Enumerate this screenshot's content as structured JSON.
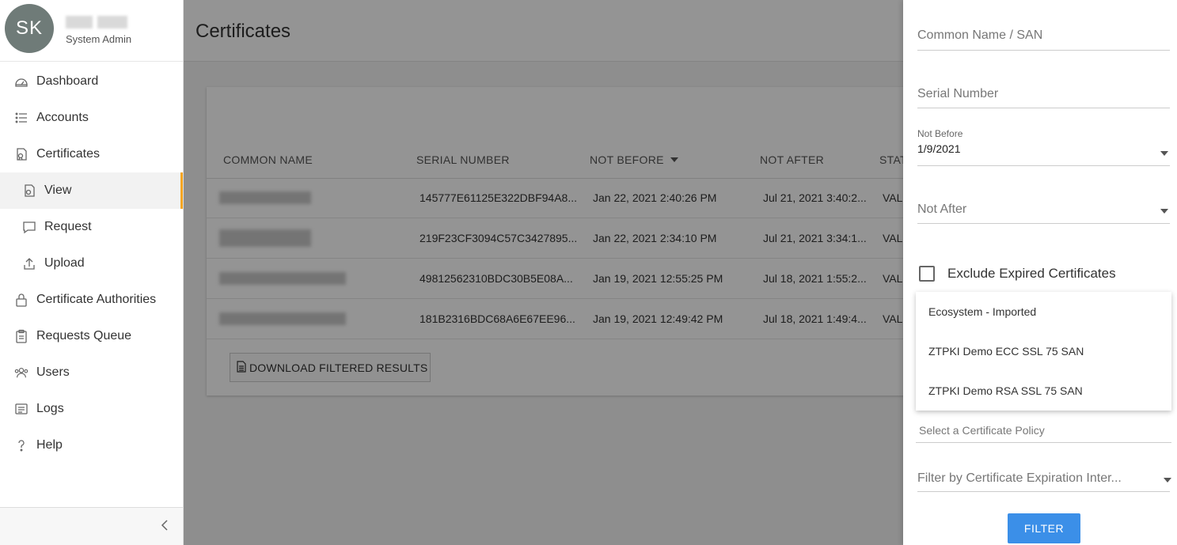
{
  "user": {
    "initials": "SK",
    "role": "System Admin"
  },
  "sidebar": {
    "items": [
      {
        "label": "Dashboard",
        "icon": "dashboard-icon"
      },
      {
        "label": "Accounts",
        "icon": "list-icon"
      },
      {
        "label": "Certificates",
        "icon": "certificate-icon"
      },
      {
        "label": "View",
        "icon": "certificate-view-icon",
        "sub": true,
        "active": true
      },
      {
        "label": "Request",
        "icon": "chat-bubble-icon",
        "sub": true
      },
      {
        "label": "Upload",
        "icon": "upload-icon",
        "sub": true
      },
      {
        "label": "Certificate Authorities",
        "icon": "lock-icon"
      },
      {
        "label": "Requests Queue",
        "icon": "clipboard-icon"
      },
      {
        "label": "Users",
        "icon": "users-icon"
      },
      {
        "label": "Logs",
        "icon": "logs-icon"
      },
      {
        "label": "Help",
        "icon": "help-icon"
      }
    ]
  },
  "page": {
    "title": "Certificates"
  },
  "table": {
    "headers": [
      "COMMON NAME",
      "SERIAL NUMBER",
      "NOT BEFORE",
      "NOT AFTER",
      "STAT"
    ],
    "rows": [
      {
        "serial": "145777E61125E322DBF94A8...",
        "not_before": "Jan 22, 2021 2:40:26 PM",
        "not_after": "Jul 21, 2021 3:40:2...",
        "status": "VAL"
      },
      {
        "serial": "219F23CF3094C57C3427895...",
        "not_before": "Jan 22, 2021 2:34:10 PM",
        "not_after": "Jul 21, 2021 3:34:1...",
        "status": "VAL"
      },
      {
        "serial": "49812562310BDC30B5E08A...",
        "not_before": "Jan 19, 2021 12:55:25 PM",
        "not_after": "Jul 18, 2021 1:55:2...",
        "status": "VAL"
      },
      {
        "serial": "181B2316BDC68A6E67EE96...",
        "not_before": "Jan 19, 2021 12:49:42 PM",
        "not_after": "Jul 18, 2021 1:49:4...",
        "status": "VAL"
      }
    ],
    "download_label": "DOWNLOAD FILTERED RESULTS"
  },
  "filter": {
    "common_name_placeholder": "Common Name / SAN",
    "serial_placeholder": "Serial Number",
    "not_before_label": "Not Before",
    "not_before_value": "1/9/2021",
    "not_after_placeholder": "Not After",
    "exclude_expired_label": "Exclude Expired Certificates",
    "policy_options": [
      "Ecosystem - Imported",
      "ZTPKI Demo ECC SSL 75 SAN",
      "ZTPKI Demo RSA SSL 75 SAN"
    ],
    "policy_placeholder": "Select a Certificate Policy",
    "expiration_placeholder": "Filter by Certificate Expiration Inter...",
    "filter_button": "FILTER"
  },
  "colors": {
    "accent": "#f5a623",
    "primary_button": "#3b8fe8",
    "avatar": "#6f7b78"
  }
}
